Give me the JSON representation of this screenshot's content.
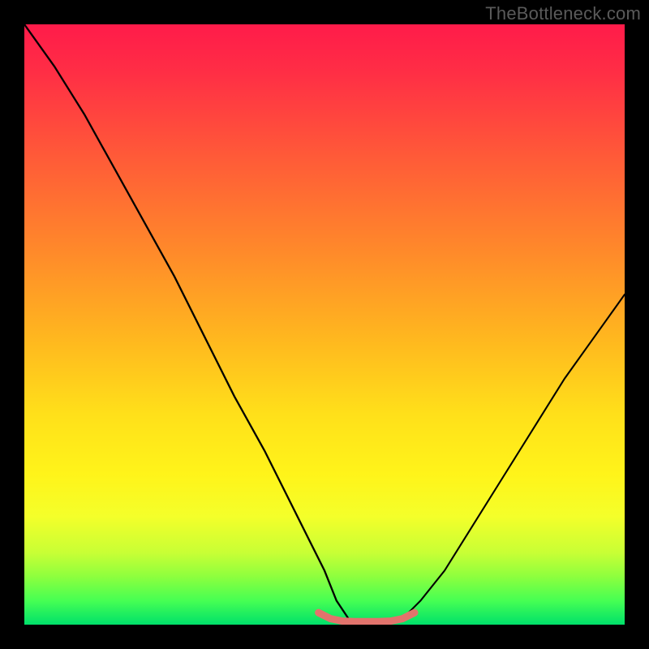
{
  "watermark": "TheBottleneck.com",
  "chart_data": {
    "type": "line",
    "title": "",
    "xlabel": "",
    "ylabel": "",
    "xlim": [
      0,
      100
    ],
    "ylim": [
      0,
      100
    ],
    "grid": false,
    "legend": false,
    "background_gradient": {
      "orientation": "vertical",
      "stops": [
        {
          "pos": 0.0,
          "color": "#ff1b4a"
        },
        {
          "pos": 0.5,
          "color": "#ffb61f"
        },
        {
          "pos": 0.8,
          "color": "#fff41a"
        },
        {
          "pos": 1.0,
          "color": "#00e06a"
        }
      ]
    },
    "series": [
      {
        "name": "left-branch",
        "color": "#000000",
        "x": [
          0,
          5,
          10,
          15,
          20,
          25,
          30,
          35,
          40,
          45,
          50,
          52,
          54
        ],
        "y": [
          100,
          93,
          85,
          76,
          67,
          58,
          48,
          38,
          29,
          19,
          9,
          4,
          1
        ]
      },
      {
        "name": "right-branch",
        "color": "#000000",
        "x": [
          63,
          66,
          70,
          75,
          80,
          85,
          90,
          95,
          100
        ],
        "y": [
          1,
          4,
          9,
          17,
          25,
          33,
          41,
          48,
          55
        ]
      },
      {
        "name": "valley-highlight",
        "color": "#e2736c",
        "x": [
          49,
          51,
          53,
          55,
          57,
          59,
          61,
          63,
          65
        ],
        "y": [
          2,
          1,
          0.6,
          0.5,
          0.5,
          0.5,
          0.6,
          1,
          2
        ]
      }
    ],
    "annotations": []
  }
}
